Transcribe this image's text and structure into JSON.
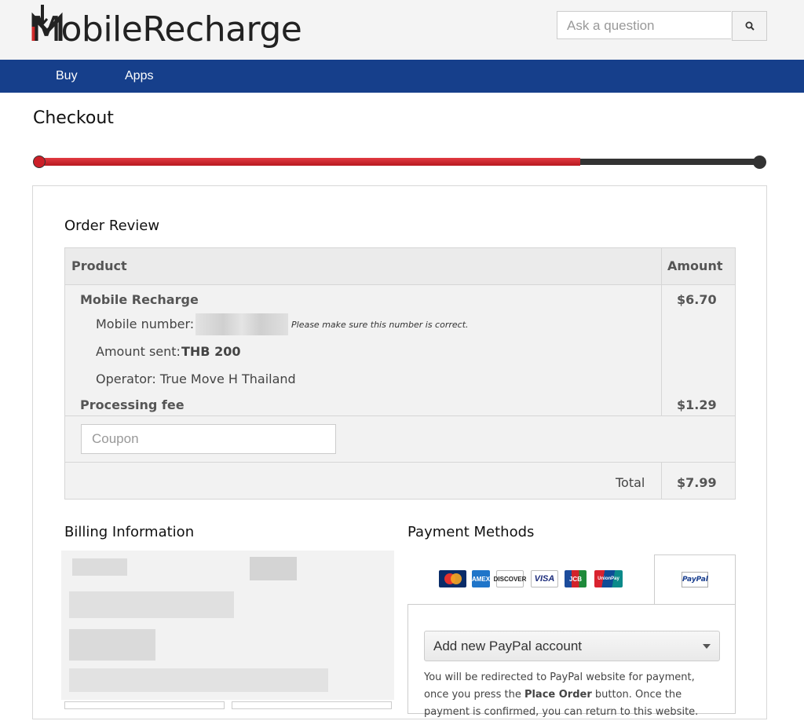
{
  "header": {
    "logo_text": "MobileRecharge",
    "search_placeholder": "Ask a question",
    "search_icon": "search-icon"
  },
  "nav": {
    "items": [
      "Buy",
      "Apps"
    ]
  },
  "page": {
    "title": "Checkout"
  },
  "progress": {
    "fraction": 0.75,
    "fill_color": "#cc1f28",
    "track_color": "#333333"
  },
  "order_review": {
    "heading": "Order Review",
    "col_product": "Product",
    "col_amount": "Amount",
    "product_name": "Mobile Recharge",
    "product_amount": "$6.70",
    "mobile_label": "Mobile number:",
    "mobile_note": "Please make sure this number is correct.",
    "amount_label": "Amount sent:",
    "amount_value": "THB 200",
    "operator_text": "Operator: True Move H Thailand",
    "fee_label": "Processing fee",
    "fee_amount": "$1.29",
    "coupon_placeholder": "Coupon",
    "total_label": "Total",
    "total_amount": "$7.99"
  },
  "billing": {
    "heading": "Billing Information"
  },
  "payment": {
    "heading": "Payment Methods",
    "cards": [
      "MasterCard",
      "American Express",
      "DISCOVER",
      "VISA",
      "JCB",
      "UnionPay"
    ],
    "paypal_tab": "PayPal",
    "select_value": "Add new PayPal account",
    "info_1": "You will be redirected to PayPal website for payment, once you press the ",
    "info_bold": "Place Order",
    "info_2": " button. Once the payment is confirmed, you can return to this website."
  },
  "colors": {
    "brand_red": "#cc1f28",
    "nav_blue": "#163f8b"
  }
}
